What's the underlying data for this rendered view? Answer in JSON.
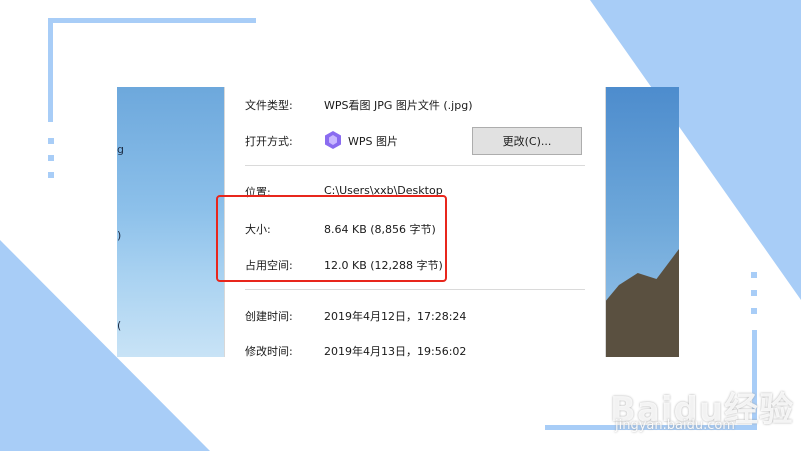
{
  "properties": {
    "file_type_label": "文件类型:",
    "file_type_value": "WPS看图 JPG 图片文件 (.jpg)",
    "open_with_label": "打开方式:",
    "open_with_value": "WPS 图片",
    "change_button": "更改(C)...",
    "location_label": "位置:",
    "location_value": "C:\\Users\\xxb\\Desktop",
    "size_label": "大小:",
    "size_value": "8.64 KB (8,856 字节)",
    "disk_size_label": "占用空间:",
    "disk_size_value": "12.0 KB (12,288 字节)",
    "created_label": "创建时间:",
    "created_value": "2019年4月12日，17:28:24",
    "modified_label": "修改时间:",
    "modified_value": "2019年4月13日，19:56:02"
  },
  "background_text": [
    "g",
    ")",
    "("
  ],
  "watermark": {
    "logo": "Baidu经验",
    "url": "jingyan.baidu.com"
  },
  "colors": {
    "accent_frame": "#a8cdf7",
    "highlight": "#e8261c",
    "app_icon": "#8a6cf0"
  },
  "icons": {
    "open_with_app": "wps-pictures-icon"
  }
}
